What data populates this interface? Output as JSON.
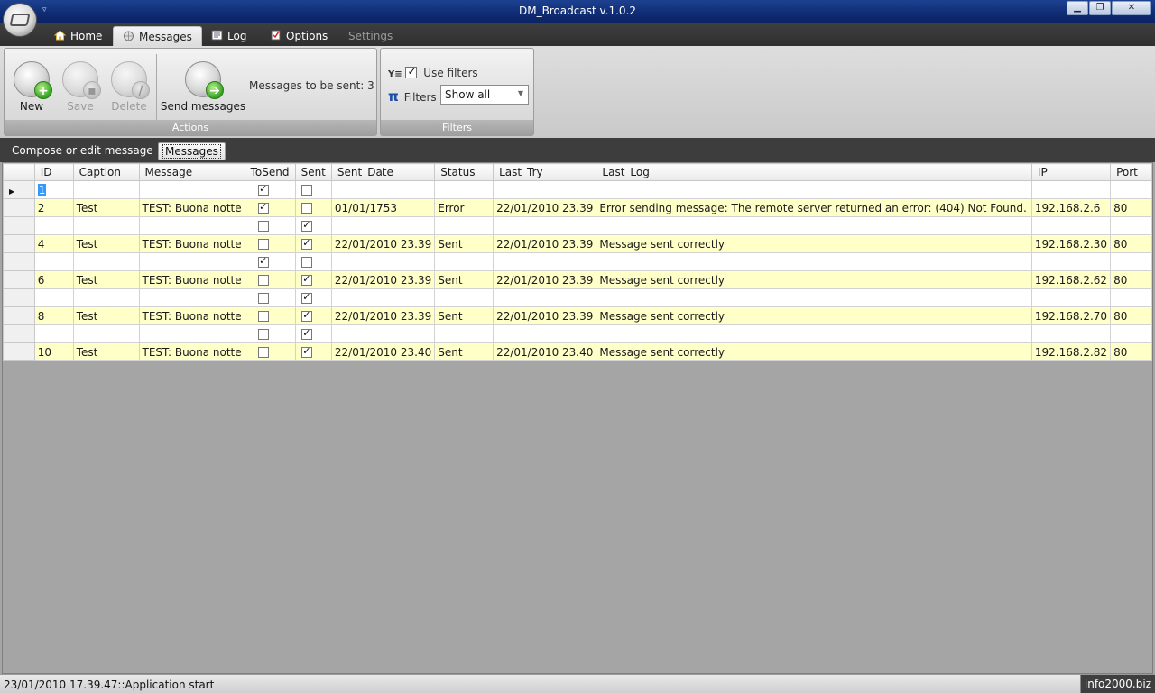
{
  "window": {
    "title": "DM_Broadcast v.1.0.2",
    "qat_symbol": "▿",
    "minimize": "▁",
    "maximize": "❐",
    "close": "✕"
  },
  "tabs": [
    {
      "label": "Home",
      "icon": "home-icon"
    },
    {
      "label": "Messages",
      "icon": "globe-icon"
    },
    {
      "label": "Log",
      "icon": "log-icon"
    },
    {
      "label": "Options",
      "icon": "checklist-icon"
    },
    {
      "label": "Settings",
      "icon": ""
    }
  ],
  "ribbon": {
    "actions": {
      "caption": "Actions",
      "new_label": "New",
      "save_label": "Save",
      "delete_label": "Delete",
      "send_label": "Send messages",
      "messages_to_send": "Messages to be sent: 3"
    },
    "filters": {
      "caption": "Filters",
      "use_filters_label": "Use filters",
      "use_filters_checked": true,
      "filters_label": "Filters",
      "filter_selected": "Show all"
    }
  },
  "inner_tabs": [
    "Compose or edit message",
    "Messages"
  ],
  "grid": {
    "columns": [
      "ID",
      "Caption",
      "Message",
      "ToSend",
      "Sent",
      "Sent_Date",
      "Status",
      "Last_Try",
      "Last_Log",
      "IP",
      "Port"
    ],
    "rows": [
      {
        "id": "1",
        "caption": "",
        "message": "",
        "tosend": true,
        "sent": false,
        "sent_date": "",
        "status": "",
        "last_try": "",
        "last_log": "",
        "ip": "",
        "port": ""
      },
      {
        "id": "2",
        "caption": "Test",
        "message": "TEST: Buona notte",
        "tosend": true,
        "sent": false,
        "sent_date": "01/01/1753",
        "status": "Error",
        "last_try": "22/01/2010 23.39",
        "last_log": "Error sending message: The remote server returned an error: (404) Not Found.",
        "ip": "192.168.2.6",
        "port": "80"
      },
      {
        "id": "",
        "caption": "",
        "message": "",
        "tosend": false,
        "sent": true,
        "sent_date": "",
        "status": "",
        "last_try": "",
        "last_log": "",
        "ip": "",
        "port": ""
      },
      {
        "id": "4",
        "caption": "Test",
        "message": "TEST: Buona notte",
        "tosend": false,
        "sent": true,
        "sent_date": "22/01/2010 23.39",
        "status": "Sent",
        "last_try": "22/01/2010 23.39",
        "last_log": "Message sent correctly",
        "ip": "192.168.2.30",
        "port": "80"
      },
      {
        "id": "",
        "caption": "",
        "message": "",
        "tosend": true,
        "sent": false,
        "sent_date": "",
        "status": "",
        "last_try": "",
        "last_log": "",
        "ip": "",
        "port": ""
      },
      {
        "id": "6",
        "caption": "Test",
        "message": "TEST: Buona notte",
        "tosend": false,
        "sent": true,
        "sent_date": "22/01/2010 23.39",
        "status": "Sent",
        "last_try": "22/01/2010 23.39",
        "last_log": "Message sent correctly",
        "ip": "192.168.2.62",
        "port": "80"
      },
      {
        "id": "",
        "caption": "",
        "message": "",
        "tosend": false,
        "sent": true,
        "sent_date": "",
        "status": "",
        "last_try": "",
        "last_log": "",
        "ip": "",
        "port": ""
      },
      {
        "id": "8",
        "caption": "Test",
        "message": "TEST: Buona notte",
        "tosend": false,
        "sent": true,
        "sent_date": "22/01/2010 23.39",
        "status": "Sent",
        "last_try": "22/01/2010 23.39",
        "last_log": "Message sent correctly",
        "ip": "192.168.2.70",
        "port": "80"
      },
      {
        "id": "",
        "caption": "",
        "message": "",
        "tosend": false,
        "sent": true,
        "sent_date": "",
        "status": "",
        "last_try": "",
        "last_log": "",
        "ip": "",
        "port": ""
      },
      {
        "id": "10",
        "caption": "Test",
        "message": "TEST: Buona notte",
        "tosend": false,
        "sent": true,
        "sent_date": "22/01/2010 23.40",
        "status": "Sent",
        "last_try": "22/01/2010 23.40",
        "last_log": "Message sent correctly",
        "ip": "192.168.2.82",
        "port": "80"
      }
    ]
  },
  "statusbar": {
    "message": "23/01/2010 17.39.47::Application start",
    "right": "info2000.biz"
  },
  "colors": {
    "titlebar": "#0f2c74",
    "alt_row": "#ffffc8",
    "selection": "#3399ff"
  }
}
